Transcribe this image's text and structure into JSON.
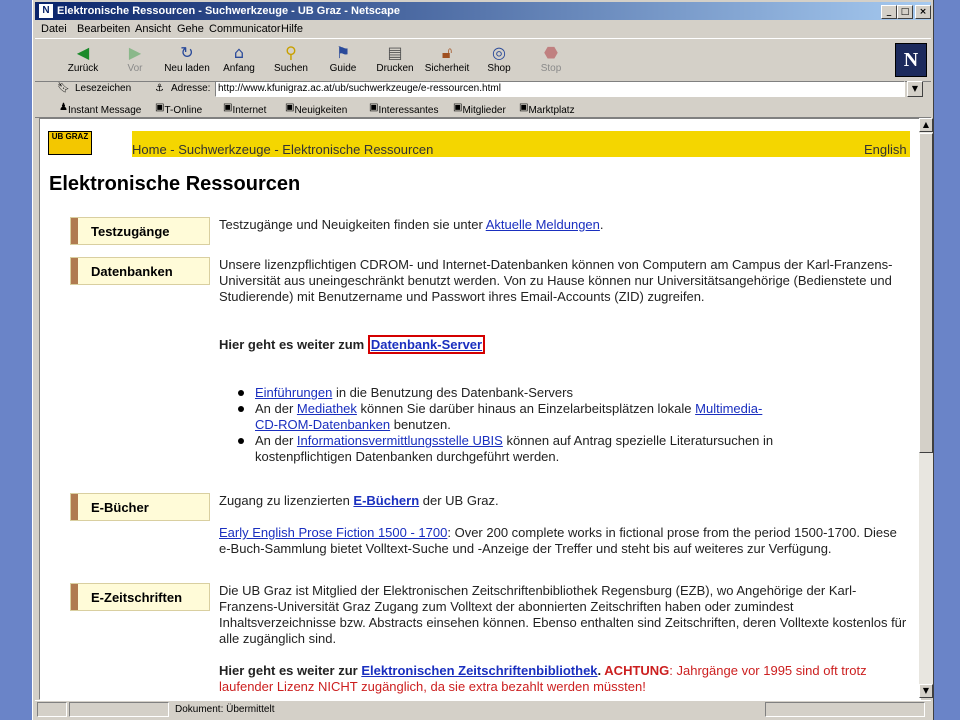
{
  "window": {
    "title": "Elektronische Ressourcen - Suchwerkzeuge - UB Graz - Netscape",
    "app_icon": "netscape-icon"
  },
  "menu": [
    "Datei",
    "Bearbeiten",
    "Ansicht",
    "Gehe",
    "Communicator",
    "Hilfe"
  ],
  "toolbar": [
    {
      "label": "Zurück",
      "icon": "back-arrow-icon",
      "enabled": true
    },
    {
      "label": "Vor",
      "icon": "forward-arrow-icon",
      "enabled": false
    },
    {
      "label": "Neu laden",
      "icon": "reload-icon",
      "enabled": true
    },
    {
      "label": "Anfang",
      "icon": "home-icon",
      "enabled": true
    },
    {
      "label": "Suchen",
      "icon": "search-icon",
      "enabled": true
    },
    {
      "label": "Guide",
      "icon": "guide-icon",
      "enabled": true
    },
    {
      "label": "Drucken",
      "icon": "print-icon",
      "enabled": true
    },
    {
      "label": "Sicherheit",
      "icon": "lock-icon",
      "enabled": true
    },
    {
      "label": "Shop",
      "icon": "shop-icon",
      "enabled": true
    },
    {
      "label": "Stop",
      "icon": "stop-icon",
      "enabled": false
    }
  ],
  "location": {
    "bookmarks_label": "Lesezeichen",
    "address_label": "Adresse:",
    "url": "http://www.kfunigraz.ac.at/ub/suchwerkzeuge/e-ressourcen.html"
  },
  "personal_toolbar": [
    "Instant Message",
    "T-Online",
    "Internet",
    "Neuigkeiten",
    "Interessantes",
    "Mitglieder",
    "Marktplatz"
  ],
  "page": {
    "logo_text": "UB GRAZ",
    "breadcrumb": "Home - Suchwerkzeuge - Elektronische Ressourcen",
    "language_link": "English",
    "heading": "Elektronische Ressourcen",
    "sections": {
      "testzugaenge": {
        "label": "Testzugänge",
        "text_before": "Testzugänge und Neuigkeiten finden sie unter ",
        "link": "Aktuelle Meldungen",
        "text_after": "."
      },
      "datenbanken": {
        "label": "Datenbanken",
        "text": "Unsere lizenzpflichtigen CDROM- und Internet-Datenbanken können von Computern am Campus der Karl-Franzens-Universität aus uneingeschränkt benutzt werden. Von zu Hause können nur Universitätsangehörige (Bedienstete und Studierende) mit Benutzername und Passwort ihres Email-Accounts (ZID) zugreifen.",
        "continue_text": "Hier geht es weiter zum ",
        "continue_link": "Datenbank-Server",
        "bullets": [
          {
            "link": "Einführungen",
            "text": " in die Benutzung des Datenbank-Servers"
          },
          {
            "pre": "An der ",
            "link": "Mediathek",
            "text": " können Sie darüber hinaus an Einzelarbeitsplätzen lokale ",
            "link2": "Multimedia-CD-ROM-Datenbanken",
            "text2": " benutzen."
          },
          {
            "pre": "An der ",
            "link": "Informationsvermittlungsstelle UBIS",
            "text": " können auf Antrag spezielle Literatursuchen in kostenpflichtigen Datenbanken durchgeführt werden."
          }
        ]
      },
      "ebuecher": {
        "label": "E-Bücher",
        "text_before": "Zugang zu lizenzierten ",
        "link": "E-Büchern",
        "text_after": " der UB Graz.",
        "eepf_link": "Early English Prose Fiction 1500 - 1700",
        "eepf_text": ": Over 200 complete works in fictional prose from the period 1500-1700. Diese e-Buch-Sammlung bietet Volltext-Suche und -Anzeige der Treffer und steht bis auf weiteres zur Verfügung."
      },
      "ezeitschriften": {
        "label": "E-Zeitschriften",
        "text": "Die UB Graz ist Mitglied der Elektronischen Zeitschriftenbibliothek Regensburg (EZB), wo Angehörige der Karl-Franzens-Universität Graz Zugang zum Volltext der abonnierten Zeitschriften haben oder zumindest Inhaltsverzeichnisse bzw. Abstracts einsehen können. Ebenso enthalten sind Zeitschriften, deren Volltexte kostenlos für alle zugänglich sind.",
        "continue_text": "Hier geht es weiter zur ",
        "continue_link": "Elektronischen Zeitschriftenbibliothek",
        "dot": ". ",
        "warning_label": "ACHTUNG",
        "warning_text": ": Jahrgänge vor 1995 sind oft trotz laufender Lizenz NICHT zugänglich, da sie extra bezahlt werden müssten!"
      }
    }
  },
  "status": {
    "text": "Dokument: Übermittelt"
  },
  "colors": {
    "yellow_bar": "#f4d600",
    "link": "#1a2fbf",
    "highlight_box": "#d40000",
    "warning": "#cc1f1f"
  }
}
